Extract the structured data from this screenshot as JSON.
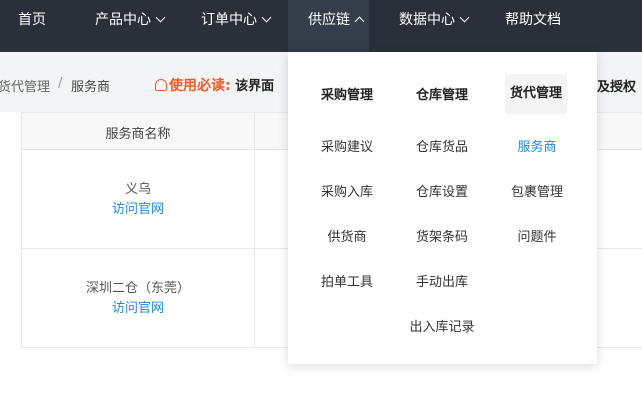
{
  "nav": {
    "items": [
      {
        "label": "首页",
        "dropdown": false
      },
      {
        "label": "产品中心",
        "dropdown": true
      },
      {
        "label": "订单中心",
        "dropdown": true
      },
      {
        "label": "供应链",
        "dropdown": true,
        "active": true
      },
      {
        "label": "数据中心",
        "dropdown": true
      },
      {
        "label": "帮助文档",
        "dropdown": false
      }
    ]
  },
  "breadcrumb": {
    "parent": "货代管理",
    "separator": "/",
    "current": "服务商"
  },
  "notice": {
    "title": "使用必读:",
    "text": "该界面",
    "right_text": "及授权"
  },
  "table": {
    "headers": [
      "服务商名称"
    ],
    "rows": [
      {
        "name": "义乌",
        "link": "访问官网"
      },
      {
        "name": "深圳二仓（东莞）",
        "link": "访问官网"
      }
    ]
  },
  "dropdown": {
    "columns": [
      {
        "heading": "采购管理",
        "items": [
          "采购建议",
          "采购入库",
          "供货商",
          "拍单工具"
        ]
      },
      {
        "heading": "仓库管理",
        "items": [
          "仓库货品",
          "仓库设置",
          "货架条码",
          "手动出库",
          "出入库记录"
        ]
      },
      {
        "heading": "货代管理",
        "items": [
          "服务商",
          "包裹管理",
          "问题件"
        ],
        "active_item": "服务商"
      }
    ]
  },
  "colors": {
    "nav_bg": "#2a2f3a",
    "accent_blue": "#1e88e5",
    "notice_orange": "#ff5722"
  }
}
